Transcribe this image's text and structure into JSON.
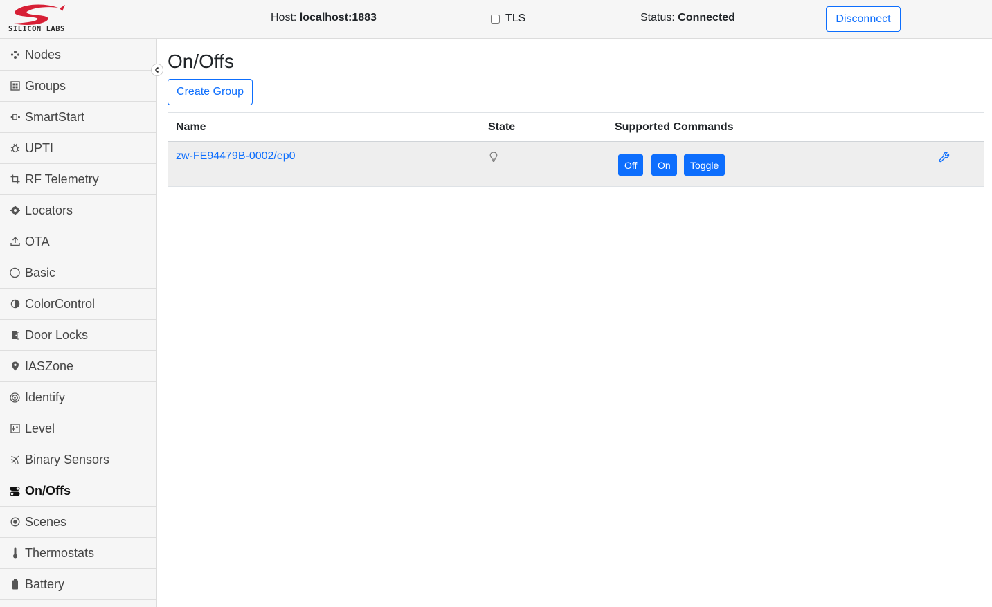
{
  "brand": {
    "logo_text": "SILICON LABS",
    "logo_color": "#d71f35"
  },
  "header": {
    "host_label": "Host:",
    "host_value": "localhost:1883",
    "tls_label": "TLS",
    "tls_checked": false,
    "status_label": "Status:",
    "status_value": "Connected",
    "disconnect_label": "Disconnect"
  },
  "sidebar": {
    "items": [
      {
        "label": "Nodes",
        "icon": "nodes-icon"
      },
      {
        "label": "Groups",
        "icon": "groups-icon"
      },
      {
        "label": "SmartStart",
        "icon": "smartstart-icon"
      },
      {
        "label": "UPTI",
        "icon": "bug-icon"
      },
      {
        "label": "RF Telemetry",
        "icon": "crop-icon"
      },
      {
        "label": "Locators",
        "icon": "gear-icon"
      },
      {
        "label": "OTA",
        "icon": "upload-icon"
      },
      {
        "label": "Basic",
        "icon": "circle-icon"
      },
      {
        "label": "ColorControl",
        "icon": "contrast-icon"
      },
      {
        "label": "Door Locks",
        "icon": "door-icon"
      },
      {
        "label": "IASZone",
        "icon": "map-pin-icon"
      },
      {
        "label": "Identify",
        "icon": "target-icon"
      },
      {
        "label": "Level",
        "icon": "sliders-icon"
      },
      {
        "label": "Binary Sensors",
        "icon": "signal-icon"
      },
      {
        "label": "On/Offs",
        "icon": "toggle-icon",
        "active": true
      },
      {
        "label": "Scenes",
        "icon": "scenes-icon"
      },
      {
        "label": "Thermostats",
        "icon": "thermometer-icon"
      },
      {
        "label": "Battery",
        "icon": "battery-icon"
      }
    ]
  },
  "main": {
    "title": "On/Offs",
    "create_group_label": "Create Group",
    "table": {
      "headers": [
        "Name",
        "State",
        "Supported Commands"
      ],
      "rows": [
        {
          "name": "zw-FE94479B-0002/ep0",
          "state_icon": "lightbulb-icon",
          "commands": [
            "Off",
            "On",
            "Toggle"
          ],
          "action_icon": "wrench-icon"
        }
      ]
    }
  },
  "colors": {
    "accent": "#0d6efd",
    "sidebar_bg": "#f6f6f6",
    "row_bg": "#eeeeee"
  }
}
